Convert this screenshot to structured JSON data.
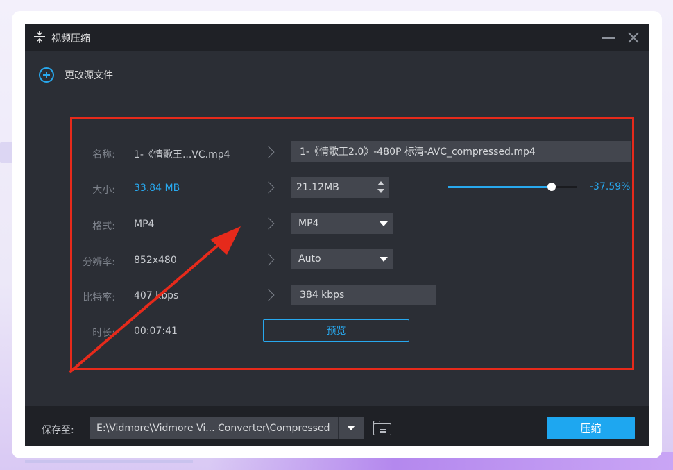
{
  "window": {
    "title": "视频压缩",
    "title_icon": "compress-icon"
  },
  "toolbar": {
    "add_source_label": "更改源文件"
  },
  "rows": {
    "name": {
      "label": "名称:",
      "source": "1-《情歌王...VC.mp4",
      "target": "1-《情歌王2.0》-480P 标清-AVC_compressed.mp4"
    },
    "size": {
      "label": "大小:",
      "source": "33.84 MB",
      "target": "21.12MB",
      "slider_fraction": 0.8,
      "percent": "-37.59%"
    },
    "format": {
      "label": "格式:",
      "source": "MP4",
      "target": "MP4"
    },
    "resolution": {
      "label": "分辨率:",
      "source": "852x480",
      "target": "Auto"
    },
    "bitrate": {
      "label": "比特率:",
      "source": "407 kbps",
      "target": "384 kbps"
    },
    "duration": {
      "label": "时长:",
      "source": "00:07:41"
    }
  },
  "preview_label": "预览",
  "footer": {
    "save_label": "保存至:",
    "path": "E:\\Vidmore\\Vidmore Vi... Converter\\Compressed",
    "compress_label": "压缩"
  },
  "colors": {
    "accent": "#28a8ee",
    "highlight_box": "#e62a1b",
    "window_bg": "#2b2e35"
  }
}
